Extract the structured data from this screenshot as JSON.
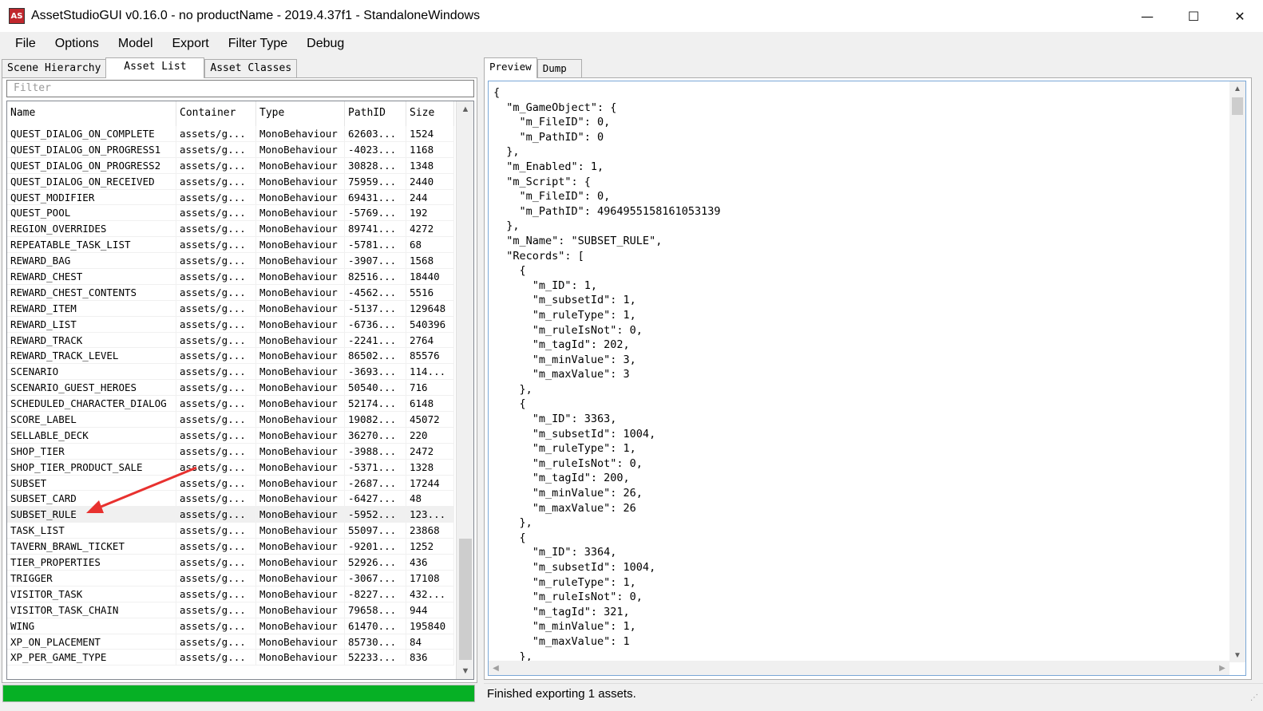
{
  "window": {
    "title": "AssetStudioGUI v0.16.0 - no productName - 2019.4.37f1 - StandaloneWindows",
    "icon_text": "AS",
    "controls": {
      "minimize": "—",
      "maximize": "☐",
      "close": "✕"
    }
  },
  "menu": [
    "File",
    "Options",
    "Model",
    "Export",
    "Filter Type",
    "Debug"
  ],
  "left_tabs": [
    "Scene Hierarchy",
    "Asset List",
    "Asset Classes"
  ],
  "left_active_tab": "Asset List",
  "filter_placeholder": "Filter",
  "columns": [
    "Name",
    "Container",
    "Type",
    "PathID",
    "Size"
  ],
  "rows": [
    [
      "QUEST_DIALOG_ON_COMPLETE",
      "assets/g...",
      "MonoBehaviour",
      "62603...",
      "1524"
    ],
    [
      "QUEST_DIALOG_ON_PROGRESS1",
      "assets/g...",
      "MonoBehaviour",
      "-4023...",
      "1168"
    ],
    [
      "QUEST_DIALOG_ON_PROGRESS2",
      "assets/g...",
      "MonoBehaviour",
      "30828...",
      "1348"
    ],
    [
      "QUEST_DIALOG_ON_RECEIVED",
      "assets/g...",
      "MonoBehaviour",
      "75959...",
      "2440"
    ],
    [
      "QUEST_MODIFIER",
      "assets/g...",
      "MonoBehaviour",
      "69431...",
      "244"
    ],
    [
      "QUEST_POOL",
      "assets/g...",
      "MonoBehaviour",
      "-5769...",
      "192"
    ],
    [
      "REGION_OVERRIDES",
      "assets/g...",
      "MonoBehaviour",
      "89741...",
      "4272"
    ],
    [
      "REPEATABLE_TASK_LIST",
      "assets/g...",
      "MonoBehaviour",
      "-5781...",
      "68"
    ],
    [
      "REWARD_BAG",
      "assets/g...",
      "MonoBehaviour",
      "-3907...",
      "1568"
    ],
    [
      "REWARD_CHEST",
      "assets/g...",
      "MonoBehaviour",
      "82516...",
      "18440"
    ],
    [
      "REWARD_CHEST_CONTENTS",
      "assets/g...",
      "MonoBehaviour",
      "-4562...",
      "5516"
    ],
    [
      "REWARD_ITEM",
      "assets/g...",
      "MonoBehaviour",
      "-5137...",
      "129648"
    ],
    [
      "REWARD_LIST",
      "assets/g...",
      "MonoBehaviour",
      "-6736...",
      "540396"
    ],
    [
      "REWARD_TRACK",
      "assets/g...",
      "MonoBehaviour",
      "-2241...",
      "2764"
    ],
    [
      "REWARD_TRACK_LEVEL",
      "assets/g...",
      "MonoBehaviour",
      "86502...",
      "85576"
    ],
    [
      "SCENARIO",
      "assets/g...",
      "MonoBehaviour",
      "-3693...",
      "114..."
    ],
    [
      "SCENARIO_GUEST_HEROES",
      "assets/g...",
      "MonoBehaviour",
      "50540...",
      "716"
    ],
    [
      "SCHEDULED_CHARACTER_DIALOG",
      "assets/g...",
      "MonoBehaviour",
      "52174...",
      "6148"
    ],
    [
      "SCORE_LABEL",
      "assets/g...",
      "MonoBehaviour",
      "19082...",
      "45072"
    ],
    [
      "SELLABLE_DECK",
      "assets/g...",
      "MonoBehaviour",
      "36270...",
      "220"
    ],
    [
      "SHOP_TIER",
      "assets/g...",
      "MonoBehaviour",
      "-3988...",
      "2472"
    ],
    [
      "SHOP_TIER_PRODUCT_SALE",
      "assets/g...",
      "MonoBehaviour",
      "-5371...",
      "1328"
    ],
    [
      "SUBSET",
      "assets/g...",
      "MonoBehaviour",
      "-2687...",
      "17244"
    ],
    [
      "SUBSET_CARD",
      "assets/g...",
      "MonoBehaviour",
      "-6427...",
      "48"
    ],
    [
      "SUBSET_RULE",
      "assets/g...",
      "MonoBehaviour",
      "-5952...",
      "123..."
    ],
    [
      "TASK_LIST",
      "assets/g...",
      "MonoBehaviour",
      "55097...",
      "23868"
    ],
    [
      "TAVERN_BRAWL_TICKET",
      "assets/g...",
      "MonoBehaviour",
      "-9201...",
      "1252"
    ],
    [
      "TIER_PROPERTIES",
      "assets/g...",
      "MonoBehaviour",
      "52926...",
      "436"
    ],
    [
      "TRIGGER",
      "assets/g...",
      "MonoBehaviour",
      "-3067...",
      "17108"
    ],
    [
      "VISITOR_TASK",
      "assets/g...",
      "MonoBehaviour",
      "-8227...",
      "432..."
    ],
    [
      "VISITOR_TASK_CHAIN",
      "assets/g...",
      "MonoBehaviour",
      "79658...",
      "944"
    ],
    [
      "WING",
      "assets/g...",
      "MonoBehaviour",
      "61470...",
      "195840"
    ],
    [
      "XP_ON_PLACEMENT",
      "assets/g...",
      "MonoBehaviour",
      "85730...",
      "84"
    ],
    [
      "XP_PER_GAME_TYPE",
      "assets/g...",
      "MonoBehaviour",
      "52233...",
      "836"
    ]
  ],
  "selected_row": "SUBSET_RULE",
  "right_tabs": [
    "Preview",
    "Dump"
  ],
  "right_active_tab": "Preview",
  "preview_lines": [
    "{",
    "  \"m_GameObject\": {",
    "    \"m_FileID\": 0,",
    "    \"m_PathID\": 0",
    "  },",
    "  \"m_Enabled\": 1,",
    "  \"m_Script\": {",
    "    \"m_FileID\": 0,",
    "    \"m_PathID\": 4964955158161053139",
    "  },",
    "  \"m_Name\": \"SUBSET_RULE\",",
    "  \"Records\": [",
    "    {",
    "      \"m_ID\": 1,",
    "      \"m_subsetId\": 1,",
    "      \"m_ruleType\": 1,",
    "      \"m_ruleIsNot\": 0,",
    "      \"m_tagId\": 202,",
    "      \"m_minValue\": 3,",
    "      \"m_maxValue\": 3",
    "    },",
    "    {",
    "      \"m_ID\": 3363,",
    "      \"m_subsetId\": 1004,",
    "      \"m_ruleType\": 1,",
    "      \"m_ruleIsNot\": 0,",
    "      \"m_tagId\": 200,",
    "      \"m_minValue\": 26,",
    "      \"m_maxValue\": 26",
    "    },",
    "    {",
    "      \"m_ID\": 3364,",
    "      \"m_subsetId\": 1004,",
    "      \"m_ruleType\": 1,",
    "      \"m_ruleIsNot\": 0,",
    "      \"m_tagId\": 321,",
    "      \"m_minValue\": 1,",
    "      \"m_maxValue\": 1",
    "    },"
  ],
  "status": "Finished exporting 1 assets.",
  "progress_fraction": 1.0,
  "colors": {
    "progress": "#06b025",
    "annotation_arrow": "#e8312f",
    "app_icon": "#c0272d"
  }
}
